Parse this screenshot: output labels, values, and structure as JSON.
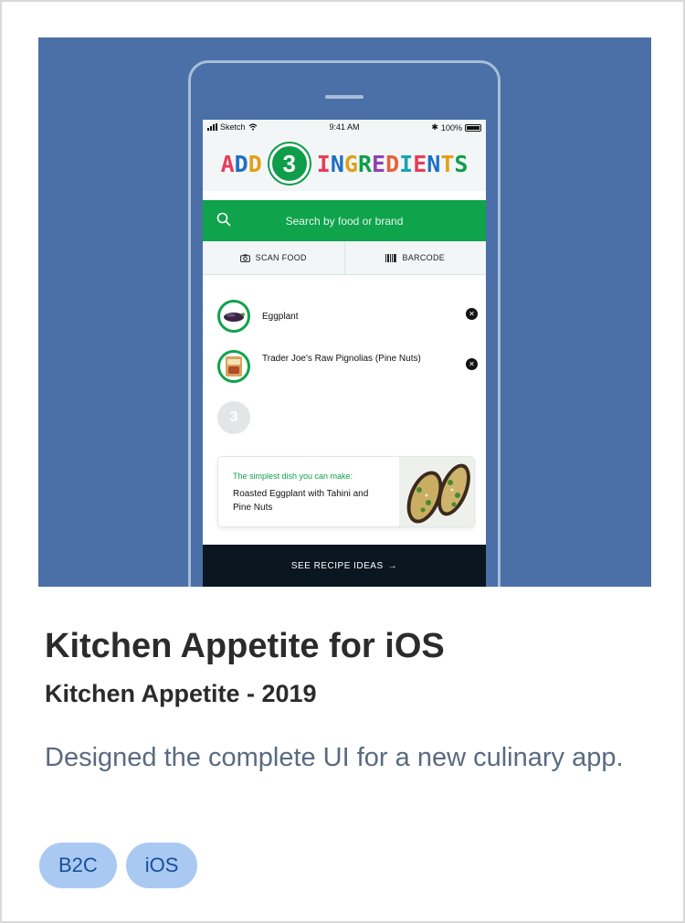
{
  "colors": {
    "hero_background": "#4a70a7",
    "brand_green": "#0fa34c",
    "cta_dark": "#0a1620",
    "tag_background": "#a9c9f2",
    "tag_text": "#1a4e9c"
  },
  "phone": {
    "status": {
      "carrier": "Sketch",
      "time": "9:41 AM",
      "battery": "100%"
    },
    "title": {
      "add": "ADD",
      "count": "3",
      "ingredients": "INGREDIENTS"
    },
    "search": {
      "icon": "search-icon",
      "placeholder": "Search by food or brand"
    },
    "actions": [
      {
        "icon": "camera-icon",
        "label": "SCAN FOOD"
      },
      {
        "icon": "barcode-icon",
        "label": "BARCODE"
      }
    ],
    "ingredients": [
      {
        "name": "Eggplant",
        "icon": "eggplant-thumbnail"
      },
      {
        "name": "Trader Joe's Raw Pignolias (Pine Nuts)",
        "icon": "pine-nuts-thumbnail"
      }
    ],
    "empty_slot": "3",
    "dish": {
      "kicker": "The simplest dish you can make:",
      "name": "Roasted Eggplant with Tahini and Pine Nuts"
    },
    "cta": {
      "label": "SEE RECIPE IDEAS",
      "icon": "arrow-right-icon"
    }
  },
  "card": {
    "title": "Kitchen Appetite for iOS",
    "subtitle": "Kitchen Appetite - 2019",
    "description": "Designed the complete UI for a new culinary app.",
    "tags": [
      "B2C",
      "iOS"
    ]
  }
}
